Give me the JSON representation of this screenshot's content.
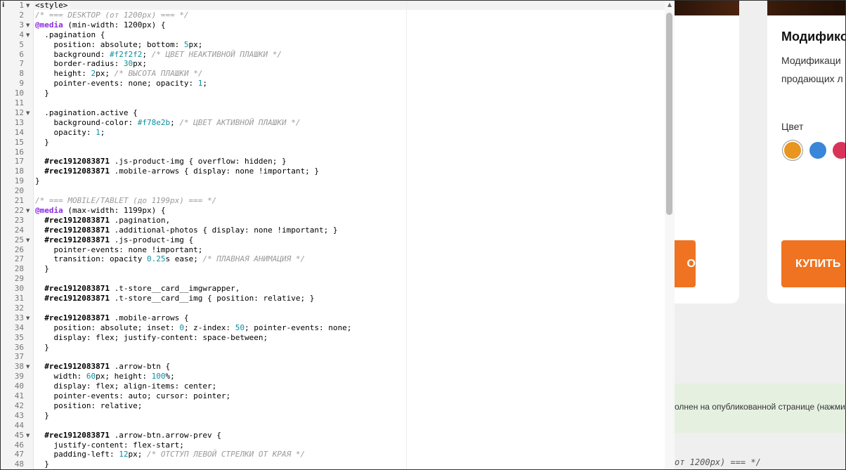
{
  "editor": {
    "lines": [
      {
        "n": "1",
        "fold": true,
        "html": "&lt;style&gt;"
      },
      {
        "n": "2",
        "html": "<span class='c-cm'>/* === DESKTOP (от 1200px) === */</span>"
      },
      {
        "n": "3",
        "fold": true,
        "html": "<span class='c-at'>@media</span> (min-width: 1200px) {"
      },
      {
        "n": "4",
        "fold": true,
        "html": "  .pagination {"
      },
      {
        "n": "5",
        "html": "    position: absolute; bottom: <span class='c-num'>5</span>px;"
      },
      {
        "n": "6",
        "html": "    background: <span class='c-hex'>#f2f2f2</span>; <span class='c-cm'>/* ЦВЕТ НЕАКТИВНОЙ ПЛАШКИ */</span>"
      },
      {
        "n": "7",
        "html": "    border-radius: <span class='c-num'>30</span>px;"
      },
      {
        "n": "8",
        "html": "    height: <span class='c-num'>2</span>px; <span class='c-cm'>/* ВЫСОТА ПЛАШКИ */</span>"
      },
      {
        "n": "9",
        "html": "    pointer-events: none; opacity: <span class='c-num'>1</span>;"
      },
      {
        "n": "10",
        "html": "  }"
      },
      {
        "n": "11",
        "html": ""
      },
      {
        "n": "12",
        "fold": true,
        "html": "  .pagination.active {"
      },
      {
        "n": "13",
        "html": "    background-color: <span class='c-hex'>#f78e2b</span>; <span class='c-cm'>/* ЦВЕТ АКТИВНОЙ ПЛАШКИ */</span>"
      },
      {
        "n": "14",
        "html": "    opacity: <span class='c-num'>1</span>;"
      },
      {
        "n": "15",
        "html": "  }"
      },
      {
        "n": "16",
        "html": ""
      },
      {
        "n": "17",
        "html": "  <span class='c-id'>#rec1912083871</span> .js-product-img { overflow: hidden; }"
      },
      {
        "n": "18",
        "html": "  <span class='c-id'>#rec1912083871</span> .mobile-arrows { display: none !important; }"
      },
      {
        "n": "19",
        "html": "}"
      },
      {
        "n": "20",
        "html": ""
      },
      {
        "n": "21",
        "html": "<span class='c-cm'>/* === MOBILE/TABLET (до 1199px) === */</span>"
      },
      {
        "n": "22",
        "fold": true,
        "html": "<span class='c-at'>@media</span> (max-width: 1199px) {"
      },
      {
        "n": "23",
        "html": "  <span class='c-id'>#rec1912083871</span> .pagination,"
      },
      {
        "n": "24",
        "html": "  <span class='c-id'>#rec1912083871</span> .additional-photos { display: none !important; }"
      },
      {
        "n": "25",
        "fold": true,
        "html": "  <span class='c-id'>#rec1912083871</span> .js-product-img {"
      },
      {
        "n": "26",
        "html": "    pointer-events: none !important;"
      },
      {
        "n": "27",
        "html": "    transition: opacity <span class='c-num'>0.25</span>s ease; <span class='c-cm'>/* ПЛАВНАЯ АНИМАЦИЯ */</span>"
      },
      {
        "n": "28",
        "html": "  }"
      },
      {
        "n": "29",
        "html": ""
      },
      {
        "n": "30",
        "html": "  <span class='c-id'>#rec1912083871</span> .t-store__card__imgwrapper,"
      },
      {
        "n": "31",
        "html": "  <span class='c-id'>#rec1912083871</span> .t-store__card__img { position: relative; }"
      },
      {
        "n": "32",
        "html": ""
      },
      {
        "n": "33",
        "fold": true,
        "html": "  <span class='c-id'>#rec1912083871</span> .mobile-arrows {"
      },
      {
        "n": "34",
        "html": "    position: absolute; inset: <span class='c-num'>0</span>; z-index: <span class='c-num'>50</span>; pointer-events: none;"
      },
      {
        "n": "35",
        "html": "    display: flex; justify-content: space-between;"
      },
      {
        "n": "36",
        "html": "  }"
      },
      {
        "n": "37",
        "html": ""
      },
      {
        "n": "38",
        "fold": true,
        "html": "  <span class='c-id'>#rec1912083871</span> .arrow-btn {"
      },
      {
        "n": "39",
        "html": "    width: <span class='c-num'>60</span>px; height: <span class='c-num'>100</span>%;"
      },
      {
        "n": "40",
        "html": "    display: flex; align-items: center;"
      },
      {
        "n": "41",
        "html": "    pointer-events: auto; cursor: pointer;"
      },
      {
        "n": "42",
        "html": "    position: relative;"
      },
      {
        "n": "43",
        "html": "  }"
      },
      {
        "n": "44",
        "html": ""
      },
      {
        "n": "45",
        "fold": true,
        "html": "  <span class='c-id'>#rec1912083871</span> .arrow-btn.arrow-prev {"
      },
      {
        "n": "46",
        "html": "    justify-content: flex-start;"
      },
      {
        "n": "47",
        "html": "    padding-left: <span class='c-num'>12</span>px; <span class='c-cm'>/* ОТСТУП ЛЕВОЙ СТРЕЛКИ ОТ КРАЯ */</span>"
      },
      {
        "n": "48",
        "html": "  }"
      }
    ]
  },
  "background": {
    "product_title": "Модифико",
    "product_desc_1": "Модификаци",
    "product_desc_2": "продающих л",
    "color_label": "Цвет",
    "swatches": [
      "#e8961f",
      "#3a86d8",
      "#d8345a"
    ],
    "buy_left": "О",
    "buy_right": "КУПИТЬ",
    "notice": "олнен на опубликованной странице (нажмите",
    "code_peek": "от 1200px) === */"
  }
}
